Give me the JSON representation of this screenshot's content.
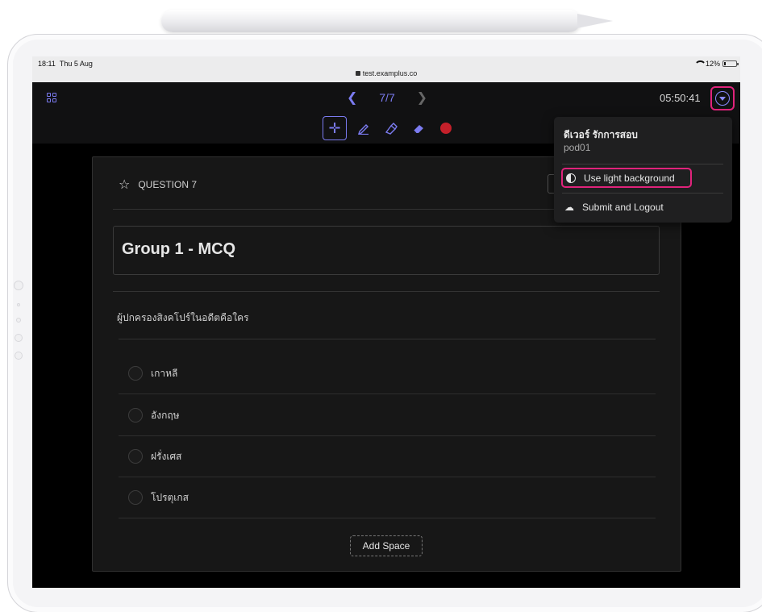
{
  "status_bar": {
    "time": "18:11",
    "date": "Thu 5 Aug",
    "url": "test.examplus.co",
    "battery": "12%"
  },
  "toolbar": {
    "page_indicator": "7/7",
    "timer": "05:50:41",
    "tools": [
      "move-icon",
      "pen-icon",
      "highlighter-icon",
      "eraser-icon",
      "record-icon"
    ]
  },
  "question": {
    "label": "QUESTION 7",
    "group_title": "Group 1 - MCQ",
    "text": "ผู้ปกครองสิงคโปร์ในอดีตคือใคร",
    "choices": [
      "เกาหลี",
      "อังกฤษ",
      "ฝรั่งเศส",
      "โปรตุเกส"
    ],
    "add_space_label": "Add Space"
  },
  "user_menu": {
    "name": "ดีเวอร์ รักการสอบ",
    "username": "pod01",
    "items": [
      {
        "label": "Use light background",
        "icon": "contrast-icon",
        "highlighted": true
      },
      {
        "label": "Submit and Logout",
        "icon": "cloud-upload-icon",
        "highlighted": false
      }
    ]
  },
  "colors": {
    "accent": "#7b7bf0",
    "highlight": "#e0237b",
    "record": "#c4202a",
    "background": "#000000"
  }
}
